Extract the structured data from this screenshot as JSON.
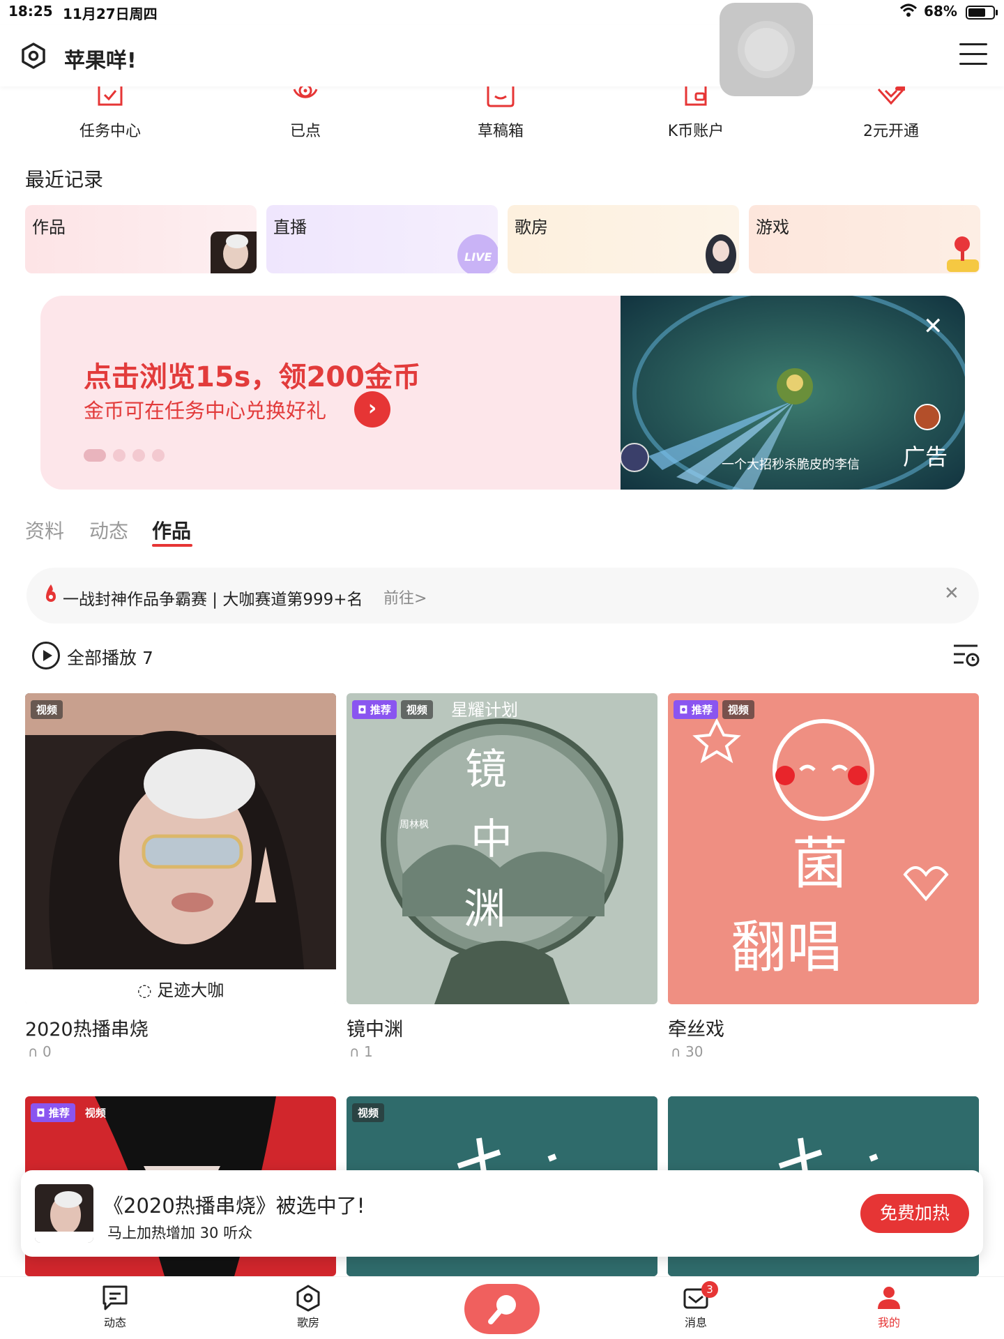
{
  "status_bar": {
    "time": "18:25",
    "date": "11月27日周四",
    "battery": "68%"
  },
  "header": {
    "title": "苹果咩!"
  },
  "quick_actions": [
    {
      "label": "任务中心",
      "icon": "task-icon"
    },
    {
      "label": "已点",
      "icon": "disc-icon"
    },
    {
      "label": "草稿箱",
      "icon": "draft-box-icon"
    },
    {
      "label": "K币账户",
      "icon": "wallet-icon"
    },
    {
      "label": "2元开通",
      "icon": "vip-icon"
    }
  ],
  "recent": {
    "title": "最近记录",
    "items": [
      {
        "label": "作品",
        "bg": "#fde8ea"
      },
      {
        "label": "直播",
        "bg": "#f1e8fd"
      },
      {
        "label": "歌房",
        "bg": "#fdf0e0"
      },
      {
        "label": "游戏",
        "bg": "#fde7e0"
      }
    ]
  },
  "banner": {
    "headline": "点击浏览15s，领200金币",
    "subline": "金币可在任务中心兑换好礼",
    "ad_caption": "一个大招秒杀脆皮的李信",
    "ad_tag": "广告",
    "dots": 4,
    "active_dot": 0
  },
  "tabs": [
    {
      "label": "资料",
      "active": false
    },
    {
      "label": "动态",
      "active": false
    },
    {
      "label": "作品",
      "active": true
    }
  ],
  "notice": {
    "text": "一战封神作品争霸赛 | 大咖赛道第999+名",
    "link": "前往>"
  },
  "play_all": {
    "label": "全部播放 7"
  },
  "works": [
    {
      "title": "2020热播串烧",
      "plays": "0",
      "badges": [
        "视频"
      ],
      "caption": "足迹大咖"
    },
    {
      "title": "镜中渊",
      "plays": "1",
      "badges": [
        "推荐",
        "视频"
      ],
      "overlay_top": "星耀计划",
      "overlay_author": "周林枫",
      "overlay_big": "镜中渊"
    },
    {
      "title": "牵丝戏",
      "plays": "30",
      "badges": [
        "推荐",
        "视频"
      ],
      "overlay_big_1": "菌",
      "overlay_big_2": "翻唱"
    },
    {
      "title": "",
      "plays": "",
      "badges": [
        "推荐",
        "视频"
      ]
    },
    {
      "title": "",
      "plays": "",
      "badges": [
        "视频"
      ]
    },
    {
      "title": "",
      "plays": "",
      "badges": []
    }
  ],
  "toast": {
    "title": "《2020热播串烧》被选中了!",
    "subtitle": "马上加热增加 30 听众",
    "button": "免费加热"
  },
  "bottom_nav": [
    {
      "label": "动态",
      "icon": "feed-icon"
    },
    {
      "label": "歌房",
      "icon": "ktv-room-icon"
    },
    {
      "label": "",
      "icon": "mic-icon"
    },
    {
      "label": "消息",
      "icon": "message-icon",
      "badge": "3"
    },
    {
      "label": "我的",
      "icon": "profile-icon",
      "active": true
    }
  ],
  "colors": {
    "accent": "#e63535",
    "recommend": "#8a55f0"
  }
}
